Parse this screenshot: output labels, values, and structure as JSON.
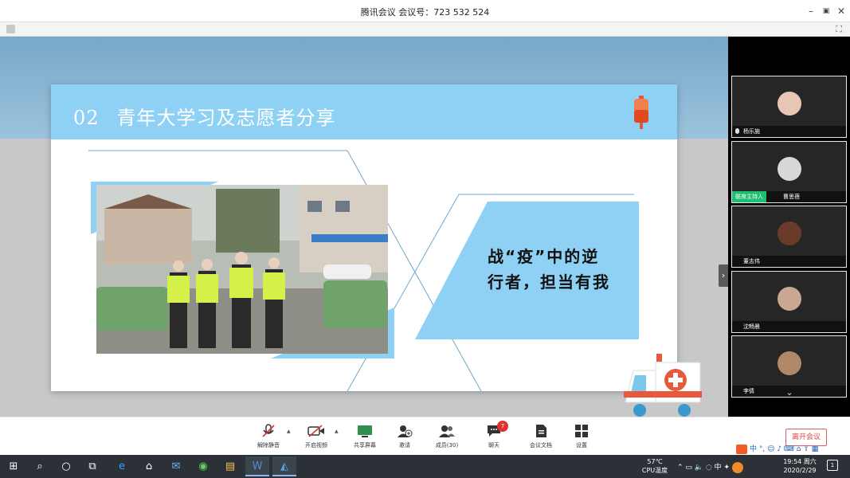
{
  "window": {
    "title": "腾讯会议 会议号：723 532 524",
    "minimize": "–",
    "restore": "▣",
    "close": "✕"
  },
  "slide": {
    "number": "02",
    "title": "青年大学习及志愿者分享",
    "slogan_line1": "战“疫”中的逆",
    "slogan_line2": "行者，担当有我"
  },
  "participants": [
    {
      "name": "杨乐施",
      "avatar_color": "#e9c5b5"
    },
    {
      "name": "曹思蓓",
      "avatar_color": "#d8d8d8",
      "role": "联席主持人"
    },
    {
      "name": "董志伟",
      "avatar_color": "#6a3b2a"
    },
    {
      "name": "沈畅晨",
      "avatar_color": "#c8a890"
    },
    {
      "name": "李倩",
      "avatar_color": "#b08868"
    }
  ],
  "controls": {
    "unmute": "解除静音",
    "video": "开启视频",
    "share": "共享屏幕",
    "invite": "邀请",
    "members": "成员(30)",
    "chat": "聊天",
    "chat_badge": "7",
    "docs": "会议文档",
    "settings": "设置",
    "leave": "离开会议"
  },
  "taskbar": {
    "weather_temp": "57℃",
    "weather_label": "CPU温度",
    "tray_text": "中",
    "clock_time": "19:54 周六",
    "clock_date": "2020/2/29",
    "notif_count": "1"
  },
  "ime": {
    "text": "中 °, ☺ ♪ ⌨ ⌂ ⇧ ▦"
  },
  "colors": {
    "accent": "#8fd1f5",
    "leave": "#e04545",
    "host_green": "#1fbf72"
  }
}
